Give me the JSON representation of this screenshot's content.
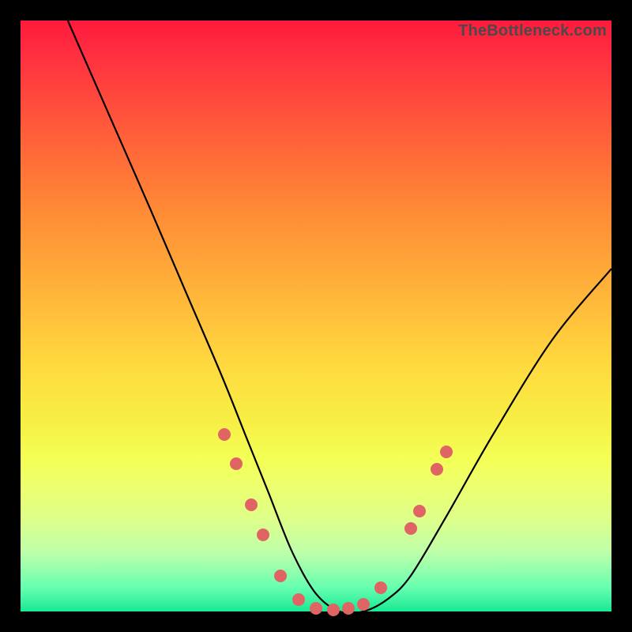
{
  "watermark": "TheBottleneck.com",
  "chart_data": {
    "type": "line",
    "title": "",
    "xlabel": "",
    "ylabel": "",
    "xlim": [
      0,
      100
    ],
    "ylim": [
      0,
      100
    ],
    "grid": false,
    "background_gradient": [
      "#ff1a3c",
      "#ff8a36",
      "#ffd93f",
      "#f4ff55",
      "#bfffaa",
      "#18e894"
    ],
    "series": [
      {
        "name": "curve",
        "color": "#000000",
        "x": [
          8,
          15,
          22,
          28,
          34,
          38,
          42,
          46,
          50,
          54,
          58,
          62,
          66,
          72,
          80,
          90,
          100
        ],
        "y": [
          100,
          84,
          68,
          54,
          40,
          30,
          20,
          10,
          3,
          0,
          0,
          2,
          6,
          16,
          30,
          46,
          58
        ]
      }
    ],
    "markers": {
      "name": "dots",
      "color": "#e06464",
      "points": [
        {
          "x": 34.5,
          "y": 30
        },
        {
          "x": 36.5,
          "y": 25
        },
        {
          "x": 39.0,
          "y": 18
        },
        {
          "x": 41.0,
          "y": 13
        },
        {
          "x": 44.0,
          "y": 6
        },
        {
          "x": 47.0,
          "y": 2
        },
        {
          "x": 50.0,
          "y": 0.5
        },
        {
          "x": 53.0,
          "y": 0.3
        },
        {
          "x": 55.5,
          "y": 0.5
        },
        {
          "x": 58.0,
          "y": 1.2
        },
        {
          "x": 61.0,
          "y": 4
        },
        {
          "x": 66.0,
          "y": 14
        },
        {
          "x": 67.5,
          "y": 17
        },
        {
          "x": 70.5,
          "y": 24
        },
        {
          "x": 72.0,
          "y": 27
        }
      ]
    }
  }
}
